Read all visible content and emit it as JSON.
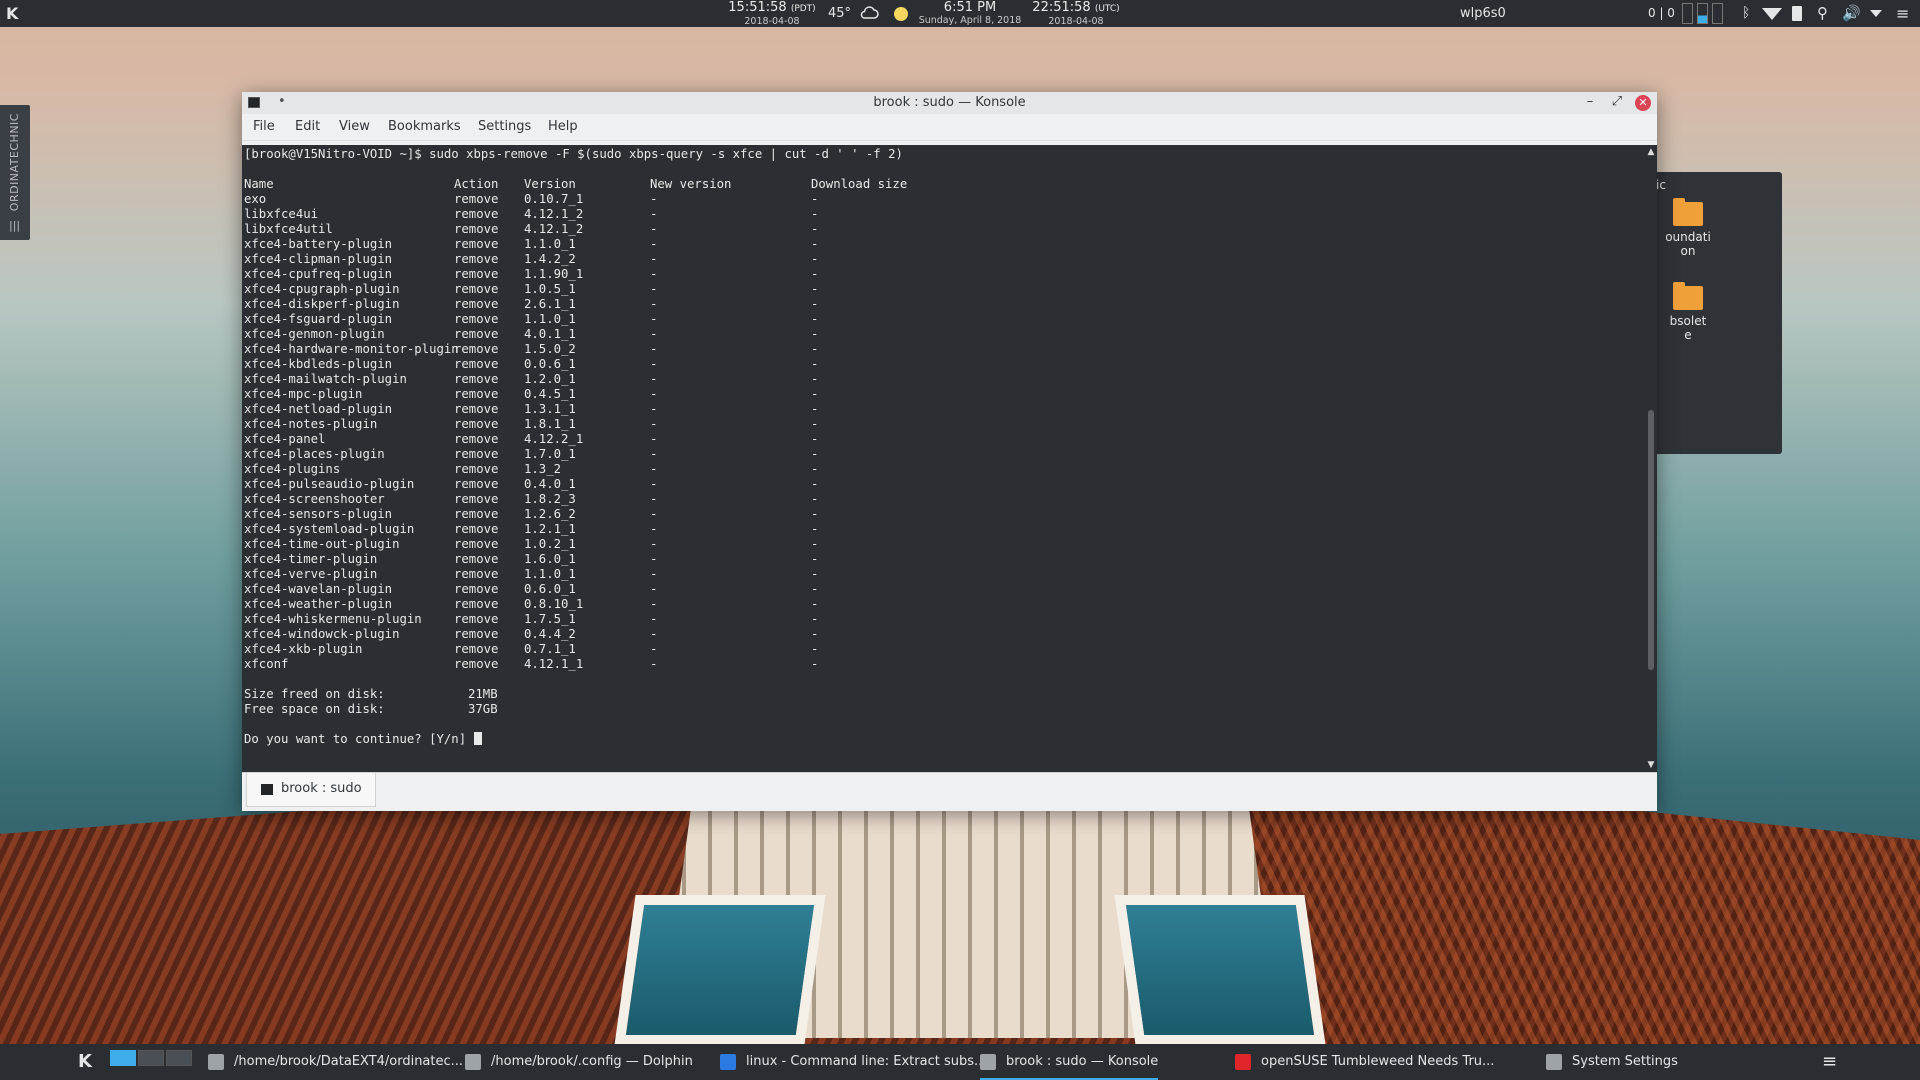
{
  "top_panel": {
    "clock_pdt": {
      "time": "15:51:58",
      "zone": "(PDT)",
      "date": "2018-04-08"
    },
    "temperature": "45°",
    "clock_local": {
      "time": "6:51 PM",
      "date": "Sunday, April 8, 2018"
    },
    "clock_utc": {
      "time": "22:51:58",
      "zone": "(UTC)",
      "date": "2018-04-08"
    },
    "network": "wlp6s0",
    "counter": "0 | 0"
  },
  "side_tab": {
    "label": "ORDINATECHNIC"
  },
  "folder_view": {
    "title": "ic",
    "items": [
      {
        "line1": "oundati",
        "line2": "on"
      },
      {
        "line1": "bsolet",
        "line2": "e"
      }
    ]
  },
  "window": {
    "title": "brook : sudo — Konsole",
    "menu": [
      "File",
      "Edit",
      "View",
      "Bookmarks",
      "Settings",
      "Help"
    ],
    "tab_label": "brook : sudo"
  },
  "terminal": {
    "prompt_line": "[brook@V15Nitro-VOID ~]$ sudo xbps-remove -F $(sudo xbps-query -s xfce | cut -d ' ' -f 2)",
    "headers": [
      "Name",
      "Action",
      "Version",
      "New version",
      "Download size"
    ],
    "rows": [
      [
        "exo",
        "remove",
        "0.10.7_1",
        "-",
        "-"
      ],
      [
        "libxfce4ui",
        "remove",
        "4.12.1_2",
        "-",
        "-"
      ],
      [
        "libxfce4util",
        "remove",
        "4.12.1_2",
        "-",
        "-"
      ],
      [
        "xfce4-battery-plugin",
        "remove",
        "1.1.0_1",
        "-",
        "-"
      ],
      [
        "xfce4-clipman-plugin",
        "remove",
        "1.4.2_2",
        "-",
        "-"
      ],
      [
        "xfce4-cpufreq-plugin",
        "remove",
        "1.1.90_1",
        "-",
        "-"
      ],
      [
        "xfce4-cpugraph-plugin",
        "remove",
        "1.0.5_1",
        "-",
        "-"
      ],
      [
        "xfce4-diskperf-plugin",
        "remove",
        "2.6.1_1",
        "-",
        "-"
      ],
      [
        "xfce4-fsguard-plugin",
        "remove",
        "1.1.0_1",
        "-",
        "-"
      ],
      [
        "xfce4-genmon-plugin",
        "remove",
        "4.0.1_1",
        "-",
        "-"
      ],
      [
        "xfce4-hardware-monitor-plugin",
        "remove",
        "1.5.0_2",
        "-",
        "-"
      ],
      [
        "xfce4-kbdleds-plugin",
        "remove",
        "0.0.6_1",
        "-",
        "-"
      ],
      [
        "xfce4-mailwatch-plugin",
        "remove",
        "1.2.0_1",
        "-",
        "-"
      ],
      [
        "xfce4-mpc-plugin",
        "remove",
        "0.4.5_1",
        "-",
        "-"
      ],
      [
        "xfce4-netload-plugin",
        "remove",
        "1.3.1_1",
        "-",
        "-"
      ],
      [
        "xfce4-notes-plugin",
        "remove",
        "1.8.1_1",
        "-",
        "-"
      ],
      [
        "xfce4-panel",
        "remove",
        "4.12.2_1",
        "-",
        "-"
      ],
      [
        "xfce4-places-plugin",
        "remove",
        "1.7.0_1",
        "-",
        "-"
      ],
      [
        "xfce4-plugins",
        "remove",
        "1.3_2",
        "-",
        "-"
      ],
      [
        "xfce4-pulseaudio-plugin",
        "remove",
        "0.4.0_1",
        "-",
        "-"
      ],
      [
        "xfce4-screenshooter",
        "remove",
        "1.8.2_3",
        "-",
        "-"
      ],
      [
        "xfce4-sensors-plugin",
        "remove",
        "1.2.6_2",
        "-",
        "-"
      ],
      [
        "xfce4-systemload-plugin",
        "remove",
        "1.2.1_1",
        "-",
        "-"
      ],
      [
        "xfce4-time-out-plugin",
        "remove",
        "1.0.2_1",
        "-",
        "-"
      ],
      [
        "xfce4-timer-plugin",
        "remove",
        "1.6.0_1",
        "-",
        "-"
      ],
      [
        "xfce4-verve-plugin",
        "remove",
        "1.1.0_1",
        "-",
        "-"
      ],
      [
        "xfce4-wavelan-plugin",
        "remove",
        "0.6.0_1",
        "-",
        "-"
      ],
      [
        "xfce4-weather-plugin",
        "remove",
        "0.8.10_1",
        "-",
        "-"
      ],
      [
        "xfce4-whiskermenu-plugin",
        "remove",
        "1.7.5_1",
        "-",
        "-"
      ],
      [
        "xfce4-windowck-plugin",
        "remove",
        "0.4.4_2",
        "-",
        "-"
      ],
      [
        "xfce4-xkb-plugin",
        "remove",
        "0.7.1_1",
        "-",
        "-"
      ],
      [
        "xfconf",
        "remove",
        "4.12.1_1",
        "-",
        "-"
      ]
    ],
    "size_freed_label": "Size freed on disk:",
    "size_freed_value": "21MB",
    "free_space_label": "Free space on disk:",
    "free_space_value": "37GB",
    "question": "Do you want to continue? [Y/n]"
  },
  "taskbar": {
    "tasks": [
      {
        "label": "/home/brook/DataEXT4/ordinatec...",
        "icon": "folder-icon",
        "color": "#9ea3a8"
      },
      {
        "label": "/home/brook/.config — Dolphin",
        "icon": "folder-icon",
        "color": "#9ea3a8"
      },
      {
        "label": "linux - Command line: Extract subs...",
        "icon": "firefox-icon",
        "color": "#2a7ae2"
      },
      {
        "label": "brook : sudo — Konsole",
        "icon": "terminal-icon",
        "color": "#9ea3a8"
      },
      {
        "label": "openSUSE Tumbleweed Needs Tru...",
        "icon": "opera-icon",
        "color": "#e0262a"
      },
      {
        "label": "System Settings",
        "icon": "gear-icon",
        "color": "#9ea3a8"
      }
    ]
  },
  "colors": {
    "accent": "#3daee9",
    "terminal_bg": "#2b2e33",
    "panel_bg": "#2a2e33",
    "close": "#da4453"
  }
}
